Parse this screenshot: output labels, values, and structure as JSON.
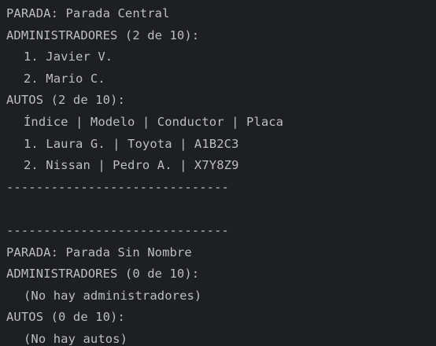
{
  "console": {
    "block1": {
      "parada": "PARADA: Parada Central",
      "admins_header": "ADMINISTRADORES (2 de 10):",
      "admins": [
        "1. Javier V.",
        "2. Mario C."
      ],
      "autos_header": "AUTOS (2 de 10):",
      "autos_columns": "Índice | Modelo | Conductor | Placa",
      "autos": [
        "1. Laura G. | Toyota | A1B2C3",
        "2. Nissan | Pedro A. | X7Y8Z9"
      ],
      "separator": "------------------------------"
    },
    "block2": {
      "separator": "------------------------------",
      "parada": "PARADA: Parada Sin Nombre",
      "admins_header": "ADMINISTRADORES (0 de 10):",
      "admins_empty": "(No hay administradores)",
      "autos_header": "AUTOS (0 de 10):",
      "autos_empty": "(No hay autos)"
    }
  }
}
